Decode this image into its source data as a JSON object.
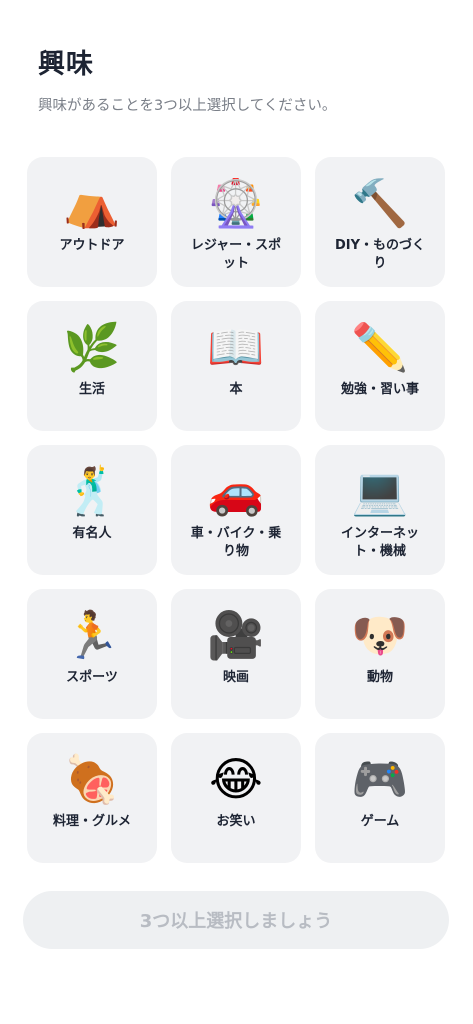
{
  "header": {
    "title": "興味",
    "subtitle": "興味があることを3つ以上選択してください。"
  },
  "interests": [
    {
      "label": "アウトドア",
      "icon": "tent-icon",
      "glyph": "⛺"
    },
    {
      "label": "レジャー・スポット",
      "icon": "ferris-wheel-icon",
      "glyph": "🎡"
    },
    {
      "label": "DIY・ものづくり",
      "icon": "hammer-icon",
      "glyph": "🔨"
    },
    {
      "label": "生活",
      "icon": "herb-icon",
      "glyph": "🌿"
    },
    {
      "label": "本",
      "icon": "open-book-icon",
      "glyph": "📖"
    },
    {
      "label": "勉強・習い事",
      "icon": "pencil-icon",
      "glyph": "✏️"
    },
    {
      "label": "有名人",
      "icon": "dancing-man-icon",
      "glyph": "🕺"
    },
    {
      "label": "車・バイク・乗り物",
      "icon": "car-icon",
      "glyph": "🚗"
    },
    {
      "label": "インターネット・機械",
      "icon": "laptop-icon",
      "glyph": "💻"
    },
    {
      "label": "スポーツ",
      "icon": "running-man-icon",
      "glyph": "🏃"
    },
    {
      "label": "映画",
      "icon": "movie-camera-icon",
      "glyph": "🎥"
    },
    {
      "label": "動物",
      "icon": "dog-face-icon",
      "glyph": "🐶"
    },
    {
      "label": "料理・グルメ",
      "icon": "meat-on-bone-icon",
      "glyph": "🍖"
    },
    {
      "label": "お笑い",
      "icon": "tears-of-joy-icon",
      "glyph": "😂"
    },
    {
      "label": "ゲーム",
      "icon": "game-controller-icon",
      "glyph": "🎮"
    }
  ],
  "footer": {
    "button_label": "3つ以上選択しましょう"
  }
}
